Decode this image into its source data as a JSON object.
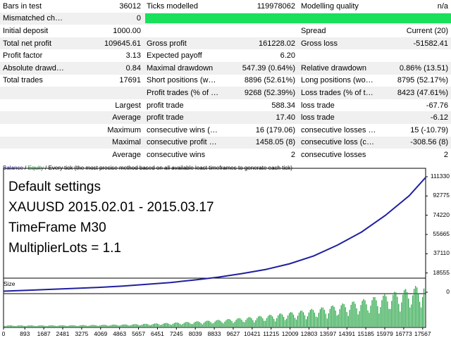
{
  "report": {
    "rows": [
      [
        {
          "t": "Bars in test"
        },
        {
          "t": "36012",
          "n": 1
        },
        {
          "t": "Ticks modelled"
        },
        {
          "t": "119978062",
          "n": 1
        },
        {
          "t": "Modelling quality"
        },
        {
          "t": "n/a",
          "n": 1
        }
      ],
      [
        {
          "t": "Mismatched charts e..."
        },
        {
          "t": "0",
          "n": 1
        },
        {
          "t": "",
          "q": 1
        },
        {
          "t": "",
          "q": 2
        },
        {
          "t": "",
          "q": 2
        },
        {
          "t": "",
          "q": 2
        }
      ],
      [
        {
          "t": "Initial deposit"
        },
        {
          "t": "1000.00",
          "n": 1
        },
        {
          "t": ""
        },
        {
          "t": ""
        },
        {
          "t": "Spread"
        },
        {
          "t": "Current (20)",
          "n": 1
        }
      ],
      [
        {
          "t": "Total net profit"
        },
        {
          "t": "109645.61",
          "n": 1
        },
        {
          "t": "Gross profit"
        },
        {
          "t": "161228.02",
          "n": 1
        },
        {
          "t": "Gross loss"
        },
        {
          "t": "-51582.41",
          "n": 1
        }
      ],
      [
        {
          "t": "Profit factor"
        },
        {
          "t": "3.13",
          "n": 1
        },
        {
          "t": "Expected payoff"
        },
        {
          "t": "6.20",
          "n": 1
        },
        {
          "t": ""
        },
        {
          "t": ""
        }
      ],
      [
        {
          "t": "Absolute drawdown"
        },
        {
          "t": "0.84",
          "n": 1
        },
        {
          "t": "Maximal drawdown"
        },
        {
          "t": "547.39 (0.64%)",
          "n": 1
        },
        {
          "t": "Relative drawdown"
        },
        {
          "t": "0.86% (13.51)",
          "n": 1
        }
      ],
      [
        {
          "t": "Total trades"
        },
        {
          "t": "17691",
          "n": 1
        },
        {
          "t": "Short positions (won %)"
        },
        {
          "t": "8896 (52.61%)",
          "n": 1
        },
        {
          "t": "Long positions (won %)"
        },
        {
          "t": "8795 (52.17%)",
          "n": 1
        }
      ],
      [
        {
          "t": ""
        },
        {
          "t": ""
        },
        {
          "t": "Profit trades (% of total)"
        },
        {
          "t": "9268 (52.39%)",
          "n": 1
        },
        {
          "t": "Loss trades (% of total)"
        },
        {
          "t": "8423 (47.61%)",
          "n": 1
        }
      ],
      [
        {
          "t": ""
        },
        {
          "t": "Largest",
          "n": 1
        },
        {
          "t": "profit trade"
        },
        {
          "t": "588.34",
          "n": 1
        },
        {
          "t": "loss trade"
        },
        {
          "t": "-67.76",
          "n": 1
        }
      ],
      [
        {
          "t": ""
        },
        {
          "t": "Average",
          "n": 1
        },
        {
          "t": "profit trade"
        },
        {
          "t": "17.40",
          "n": 1
        },
        {
          "t": "loss trade"
        },
        {
          "t": "-6.12",
          "n": 1
        }
      ],
      [
        {
          "t": ""
        },
        {
          "t": "Maximum",
          "n": 1
        },
        {
          "t": "consecutive wins (profit i..."
        },
        {
          "t": "16 (179.06)",
          "n": 1
        },
        {
          "t": "consecutive losses (loss i..."
        },
        {
          "t": "15 (-10.79)",
          "n": 1
        }
      ],
      [
        {
          "t": ""
        },
        {
          "t": "Maximal",
          "n": 1
        },
        {
          "t": "consecutive profit (count..."
        },
        {
          "t": "1458.05 (8)",
          "n": 1
        },
        {
          "t": "consecutive loss (count o..."
        },
        {
          "t": "-308.56 (8)",
          "n": 1
        }
      ],
      [
        {
          "t": ""
        },
        {
          "t": "Average",
          "n": 1
        },
        {
          "t": "consecutive wins"
        },
        {
          "t": "2",
          "n": 1
        },
        {
          "t": "consecutive losses"
        },
        {
          "t": "2",
          "n": 1
        }
      ]
    ]
  },
  "chart": {
    "legend_balance": "Balance",
    "legend_sep": " / ",
    "legend_equity": "Equity",
    "legend_rest": " / Every tick (the most precise method based on all available least timeframes to generate each tick)",
    "overlay_lines": [
      "Default settings",
      "XAUUSD 2015.02.01 - 2015.03.17",
      "TimeFrame M30",
      "MultiplierLots = 1.1"
    ],
    "size_label": "Size",
    "colors": {
      "balance": "#1f1fa0",
      "volume": "#1aa03a",
      "quality": "#19e05a"
    }
  },
  "chart_data": {
    "type": "line",
    "title": "",
    "series": [
      {
        "name": "Balance",
        "x": [
          0,
          1000,
          2000,
          3000,
          4000,
          5000,
          6000,
          7000,
          8000,
          9000,
          10000,
          11000,
          12000,
          13000,
          14000,
          15000,
          16000,
          17000,
          17691
        ],
        "values": [
          1000,
          1900,
          2800,
          3700,
          4700,
          6000,
          7600,
          9400,
          11800,
          14500,
          18000,
          22000,
          27500,
          35000,
          45500,
          58000,
          74000,
          93000,
          110646
        ]
      }
    ],
    "y_ticks": [
      "111330",
      "92775",
      "74220",
      "55665",
      "37110",
      "18555",
      "0"
    ],
    "x_ticks": [
      "0",
      "893",
      "1687",
      "2481",
      "3275",
      "4069",
      "4863",
      "5657",
      "6451",
      "7245",
      "8039",
      "8833",
      "9627",
      "10421",
      "11215",
      "12009",
      "12803",
      "13597",
      "14391",
      "15185",
      "15979",
      "16773",
      "17567"
    ],
    "ylim": [
      0,
      111330
    ],
    "xlim": [
      0,
      17691
    ]
  }
}
